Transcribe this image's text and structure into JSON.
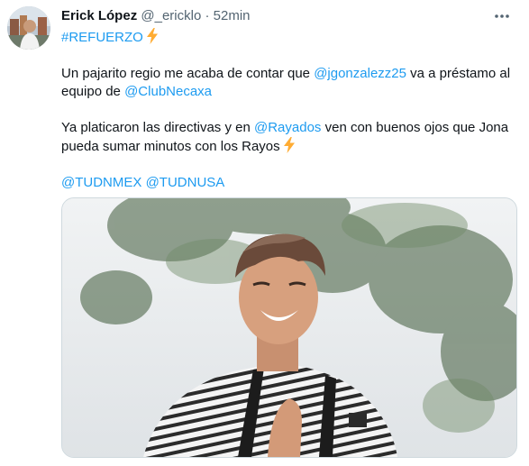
{
  "user": {
    "name": "Erick López",
    "handle": "@_ericklo",
    "separator": "·",
    "time": "52min"
  },
  "tweet": {
    "hashtag": "#REFUERZO",
    "line1_a": "Un pajarito regio me acaba de contar que ",
    "mention_jonz": "@jgonzalezz25",
    "line1_b": " va a préstamo al equipo de ",
    "mention_necaxa": "@ClubNecaxa",
    "line2_a": "Ya platicaron las directivas y en ",
    "mention_rayados": "@Rayados",
    "line2_b": " ven con buenos ojos que Jona pueda sumar minutos con los Rayos",
    "mention_tudnmex": "@TUDNMEX",
    "mention_tudnusa": "@TUDNUSA"
  },
  "colors": {
    "link": "#1d9bf0",
    "secondary_text": "#536471",
    "bolt": "#ffac33"
  },
  "icons": {
    "more": "more-horizontal-icon",
    "bolt": "high-voltage-emoji"
  }
}
